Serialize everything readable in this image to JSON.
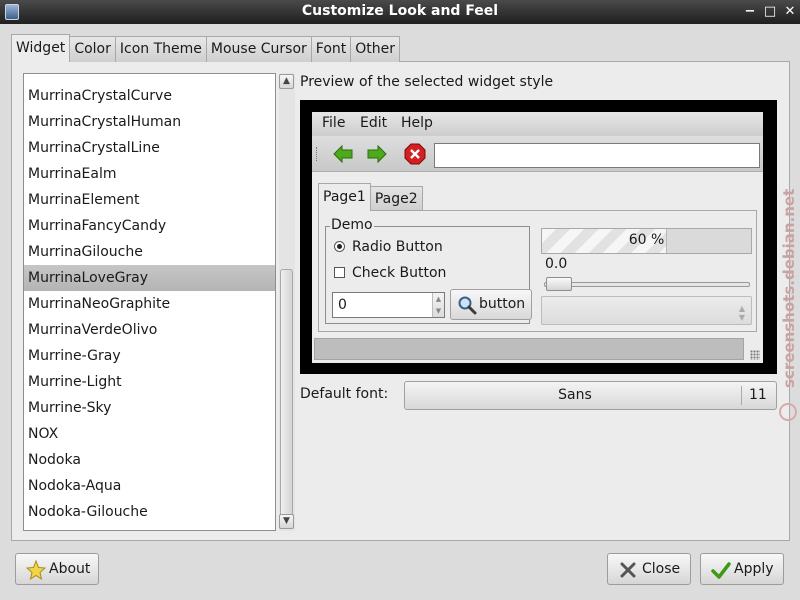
{
  "window": {
    "title": "Customize Look and Feel",
    "controls": {
      "minimize": "−",
      "maximize": "□",
      "close": "✕"
    }
  },
  "tabs": [
    {
      "label": "Widget",
      "active": true
    },
    {
      "label": "Color"
    },
    {
      "label": "Icon Theme"
    },
    {
      "label": "Mouse Cursor"
    },
    {
      "label": "Font"
    },
    {
      "label": "Other"
    }
  ],
  "theme_list": {
    "items": [
      "MurrinaCrystalCurve",
      "MurrinaCrystalHuman",
      "MurrinaCrystalLine",
      "MurrinaEalm",
      "MurrinaElement",
      "MurrinaFancyCandy",
      "MurrinaGilouche",
      "MurrinaLoveGray",
      "MurrinaNeoGraphite",
      "MurrinaVerdeOlivo",
      "Murrine-Gray",
      "Murrine-Light",
      "Murrine-Sky",
      "NOX",
      "Nodoka",
      "Nodoka-Aqua",
      "Nodoka-Gilouche"
    ],
    "selected": "MurrinaLoveGray"
  },
  "preview": {
    "label": "Preview of the selected widget style",
    "menus": [
      "File",
      "Edit",
      "Help"
    ],
    "toolbar_icons": [
      "back-arrow-icon",
      "forward-arrow-icon",
      "stop-icon"
    ],
    "entry_value": "",
    "tabs": [
      "Page1",
      "Page2"
    ],
    "frame_title": "Demo",
    "radio_label": "Radio Button",
    "check_label": "Check Button",
    "spin_value": "0",
    "button_label": "button",
    "progress_text": "60 %",
    "progress_fraction": 0.6,
    "scale_value": "0.0"
  },
  "default_font": {
    "label": "Default font:",
    "name": "Sans",
    "size": "11"
  },
  "buttons": {
    "about": "About",
    "close": "Close",
    "apply": "Apply"
  },
  "watermark": "screenshots.debian.net",
  "colors": {
    "selection": "#bdbdbd",
    "title_bar": "#2e2e2e",
    "stop_icon": "#d42020",
    "arrow_icon": "#4caa1c"
  }
}
